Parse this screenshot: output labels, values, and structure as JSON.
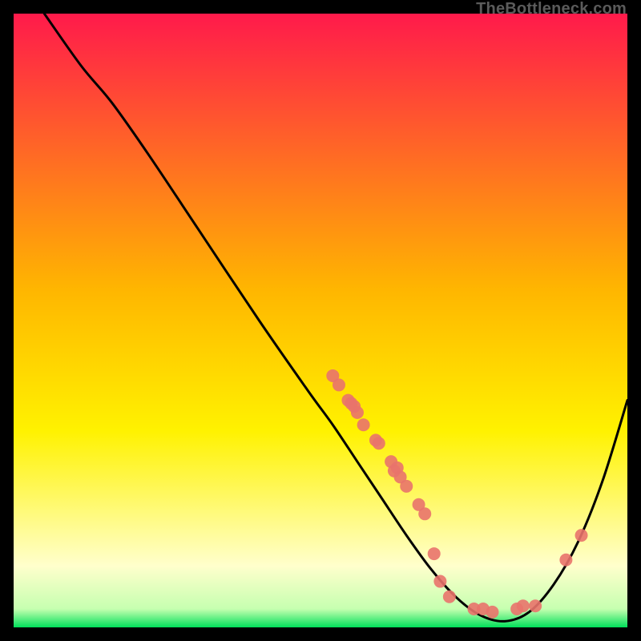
{
  "credit": "TheBottleneck.com",
  "colors": {
    "top": "#ff1a4b",
    "mid_upper": "#ffb600",
    "mid_lower": "#fff200",
    "pale": "#ffffcc",
    "bottom": "#00e05a",
    "curve": "#000000",
    "marker": "#e9736b",
    "frame_bg": "#000000"
  },
  "chart_data": {
    "type": "line",
    "title": "",
    "xlabel": "",
    "ylabel": "",
    "xlim": [
      0,
      100
    ],
    "ylim": [
      0,
      100
    ],
    "grid": false,
    "legend": false,
    "curve": [
      {
        "x": 5.0,
        "y": 100.0
      },
      {
        "x": 11.0,
        "y": 91.5
      },
      {
        "x": 16.0,
        "y": 85.5
      },
      {
        "x": 22.0,
        "y": 77.0
      },
      {
        "x": 30.0,
        "y": 65.0
      },
      {
        "x": 40.0,
        "y": 50.0
      },
      {
        "x": 48.0,
        "y": 38.5
      },
      {
        "x": 52.0,
        "y": 33.0
      },
      {
        "x": 56.0,
        "y": 27.0
      },
      {
        "x": 60.0,
        "y": 21.0
      },
      {
        "x": 64.0,
        "y": 15.0
      },
      {
        "x": 68.0,
        "y": 9.5
      },
      {
        "x": 72.0,
        "y": 5.0
      },
      {
        "x": 76.0,
        "y": 2.0
      },
      {
        "x": 80.0,
        "y": 1.0
      },
      {
        "x": 84.0,
        "y": 2.5
      },
      {
        "x": 88.0,
        "y": 7.0
      },
      {
        "x": 92.0,
        "y": 14.0
      },
      {
        "x": 96.0,
        "y": 24.0
      },
      {
        "x": 100.0,
        "y": 37.0
      }
    ],
    "series": [
      {
        "name": "markers",
        "points": [
          {
            "x": 52.0,
            "y": 41.0
          },
          {
            "x": 53.0,
            "y": 39.5
          },
          {
            "x": 54.5,
            "y": 37.0
          },
          {
            "x": 55.0,
            "y": 36.5
          },
          {
            "x": 55.5,
            "y": 36.0
          },
          {
            "x": 56.0,
            "y": 35.0
          },
          {
            "x": 57.0,
            "y": 33.0
          },
          {
            "x": 59.0,
            "y": 30.5
          },
          {
            "x": 59.5,
            "y": 30.0
          },
          {
            "x": 61.5,
            "y": 27.0
          },
          {
            "x": 62.0,
            "y": 25.5
          },
          {
            "x": 62.5,
            "y": 26.0
          },
          {
            "x": 63.0,
            "y": 24.5
          },
          {
            "x": 64.0,
            "y": 23.0
          },
          {
            "x": 66.0,
            "y": 20.0
          },
          {
            "x": 67.0,
            "y": 18.5
          },
          {
            "x": 68.5,
            "y": 12.0
          },
          {
            "x": 69.5,
            "y": 7.5
          },
          {
            "x": 71.0,
            "y": 5.0
          },
          {
            "x": 75.0,
            "y": 3.0
          },
          {
            "x": 76.5,
            "y": 3.0
          },
          {
            "x": 78.0,
            "y": 2.5
          },
          {
            "x": 82.0,
            "y": 3.0
          },
          {
            "x": 83.0,
            "y": 3.5
          },
          {
            "x": 85.0,
            "y": 3.5
          },
          {
            "x": 90.0,
            "y": 11.0
          },
          {
            "x": 92.5,
            "y": 15.0
          }
        ]
      }
    ]
  }
}
